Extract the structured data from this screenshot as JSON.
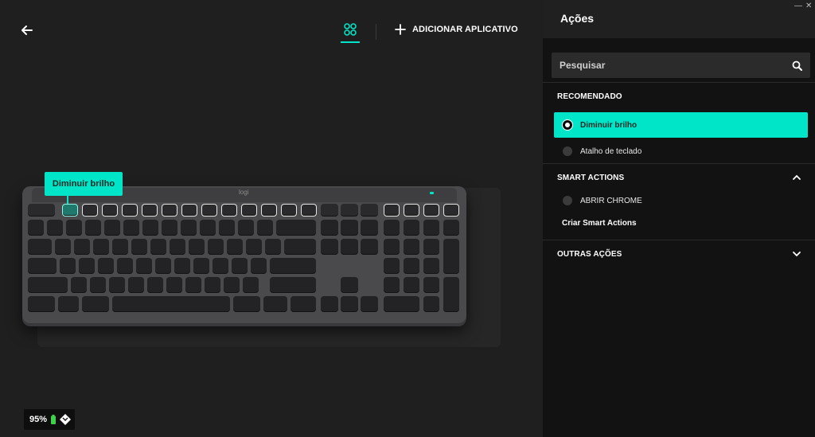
{
  "tooltip": {
    "text": "Diminuir brilho"
  },
  "header": {
    "add_app_label": "ADICIONAR APLICATIVO"
  },
  "battery": {
    "percent": "95%",
    "color": "#3fd14a"
  },
  "keyboard": {
    "logo": "logi"
  },
  "panel": {
    "title": "Ações",
    "min_glyph": "—",
    "close_glyph": "✕",
    "search": {
      "placeholder": "Pesquisar"
    },
    "recommended": {
      "title": "RECOMENDADO",
      "options": [
        {
          "label": "Diminuir brilho",
          "selected": true
        },
        {
          "label": "Atalho de teclado",
          "selected": false
        }
      ]
    },
    "smart_actions": {
      "title": "SMART ACTIONS",
      "options": [
        {
          "label": "ABRIR CHROME"
        }
      ],
      "create_label": "Criar Smart Actions"
    },
    "other_actions": {
      "title": "OUTRAS AÇÕES"
    }
  },
  "colors": {
    "accent": "#00e5c7",
    "panel_bg": "#121212",
    "main_bg": "#1f1f1f"
  }
}
